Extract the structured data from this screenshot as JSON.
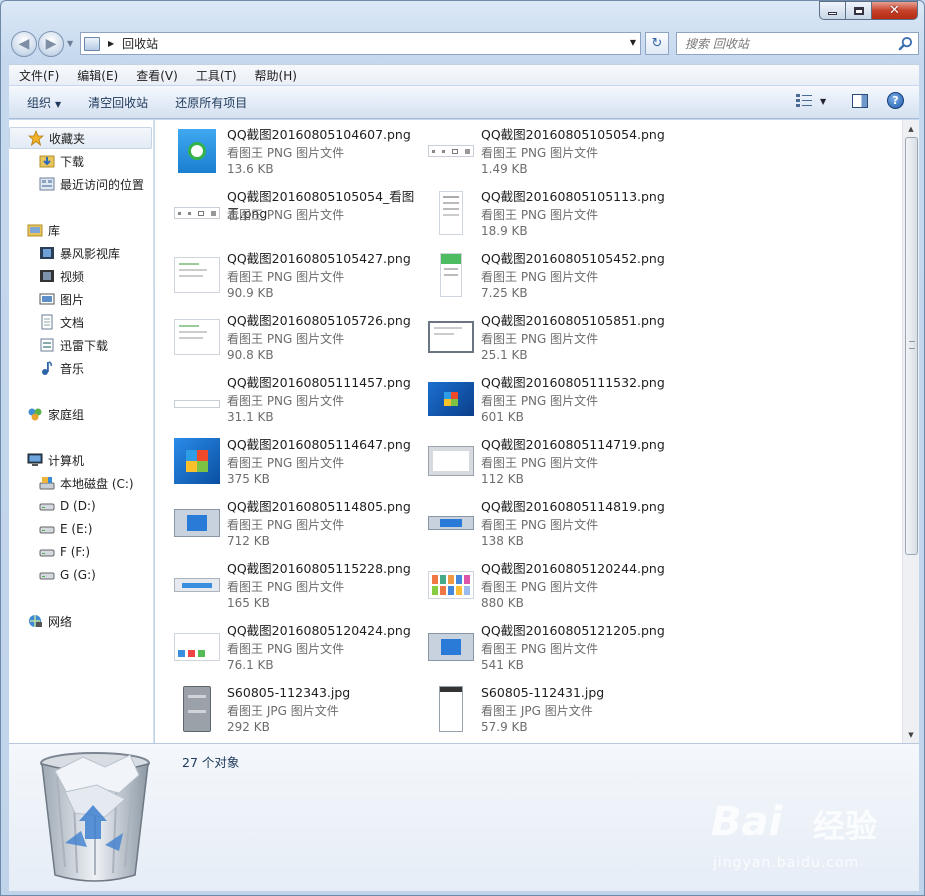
{
  "window": {
    "caption_buttons": [
      "minimize-icon",
      "maximize-icon",
      "close-icon"
    ]
  },
  "address_bar": {
    "path": "回收站",
    "search_placeholder": "搜索 回收站"
  },
  "menu": [
    "文件(F)",
    "编辑(E)",
    "查看(V)",
    "工具(T)",
    "帮助(H)"
  ],
  "toolbar": {
    "organize": "组织",
    "empty_bin": "清空回收站",
    "restore_all": "还原所有项目"
  },
  "nav": {
    "favorites": "收藏夹",
    "downloads": "下载",
    "recent": "最近访问的位置",
    "libraries": "库",
    "storm_video": "暴风影视库",
    "videos": "视频",
    "pictures": "图片",
    "documents": "文档",
    "xunlei": "迅雷下载",
    "music": "音乐",
    "homegroup": "家庭组",
    "computer": "计算机",
    "drive_c": "本地磁盘 (C:)",
    "drive_d": "D (D:)",
    "drive_e": "E (E:)",
    "drive_f": "F (F:)",
    "drive_g": "G (G:)",
    "network": "网络"
  },
  "files": [
    {
      "name": "QQ截图20160805104607.png",
      "type": "看图王 PNG 图片文件",
      "size": "13.6 KB",
      "thumb": "green-logo"
    },
    {
      "name": "QQ截图20160805105054.png",
      "type": "看图王 PNG 图片文件",
      "size": "1.49 KB",
      "thumb": "strip"
    },
    {
      "name": "QQ截图20160805105054_看图王.png",
      "type": "看图王 PNG 图片文件",
      "size": "",
      "thumb": "strip"
    },
    {
      "name": "QQ截图20160805105113.png",
      "type": "看图王 PNG 图片文件",
      "size": "18.9 KB",
      "thumb": "portrait-doc"
    },
    {
      "name": "QQ截图20160805105427.png",
      "type": "看图王 PNG 图片文件",
      "size": "90.9 KB",
      "thumb": "dialog"
    },
    {
      "name": "QQ截图20160805105452.png",
      "type": "看图王 PNG 图片文件",
      "size": "7.25 KB",
      "thumb": "portrait-green"
    },
    {
      "name": "QQ截图20160805105726.png",
      "type": "看图王 PNG 图片文件",
      "size": "90.8 KB",
      "thumb": "dialog"
    },
    {
      "name": "QQ截图20160805105851.png",
      "type": "看图王 PNG 图片文件",
      "size": "25.1 KB",
      "thumb": "dialog-border"
    },
    {
      "name": "QQ截图20160805111457.png",
      "type": "看图王 PNG 图片文件",
      "size": "31.1 KB",
      "thumb": "strip-low"
    },
    {
      "name": "QQ截图20160805111532.png",
      "type": "看图王 PNG 图片文件",
      "size": "601 KB",
      "thumb": "win7-desktop"
    },
    {
      "name": "QQ截图20160805114647.png",
      "type": "看图王 PNG 图片文件",
      "size": "375 KB",
      "thumb": "win7-logo"
    },
    {
      "name": "QQ截图20160805114719.png",
      "type": "看图王 PNG 图片文件",
      "size": "112 KB",
      "thumb": "gray-window"
    },
    {
      "name": "QQ截图20160805114805.png",
      "type": "看图王 PNG 图片文件",
      "size": "712 KB",
      "thumb": "window-blue"
    },
    {
      "name": "QQ截图20160805114819.png",
      "type": "看图王 PNG 图片文件",
      "size": "138 KB",
      "thumb": "blue-strip"
    },
    {
      "name": "QQ截图20160805115228.png",
      "type": "看图王 PNG 图片文件",
      "size": "165 KB",
      "thumb": "blue-bar"
    },
    {
      "name": "QQ截图20160805120244.png",
      "type": "看图王 PNG 图片文件",
      "size": "880 KB",
      "thumb": "colorful-grid"
    },
    {
      "name": "QQ截图20160805120424.png",
      "type": "看图王 PNG 图片文件",
      "size": "76.1 KB",
      "thumb": "dialog-icons"
    },
    {
      "name": "QQ截图20160805121205.png",
      "type": "看图王 PNG 图片文件",
      "size": "541 KB",
      "thumb": "window-blue"
    },
    {
      "name": "S60805-112343.jpg",
      "type": "看图王 JPG 图片文件",
      "size": "292 KB",
      "thumb": "phone-gray"
    },
    {
      "name": "S60805-112431.jpg",
      "type": "看图王 JPG 图片文件",
      "size": "57.9 KB",
      "thumb": "phone-white"
    }
  ],
  "status": {
    "count": "27 个对象"
  },
  "watermark": {
    "brand": "Bai",
    "brand_cn": "经验",
    "url": "jingyan.baidu.com"
  }
}
